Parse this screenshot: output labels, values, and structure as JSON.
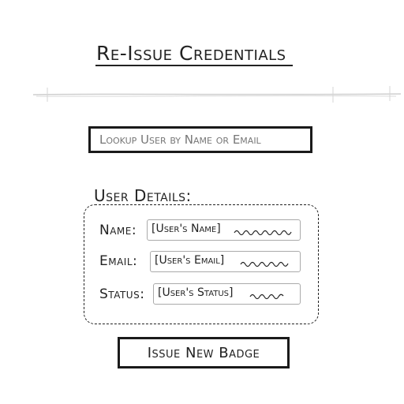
{
  "page": {
    "title": "Re-Issue Credentials"
  },
  "search": {
    "placeholder": "Lookup User by Name or Email"
  },
  "details": {
    "heading": "User Details:",
    "fields": [
      {
        "label": "Name:",
        "value": "[User's Name]"
      },
      {
        "label": "Email:",
        "value": "[User's Email]"
      },
      {
        "label": "Status:",
        "value": "[User's Status]"
      }
    ]
  },
  "actions": {
    "issue_badge_label": "Issue New Badge"
  },
  "colors": {
    "ink": "#222222",
    "faint_line": "#cccccc",
    "placeholder": "#777777"
  }
}
